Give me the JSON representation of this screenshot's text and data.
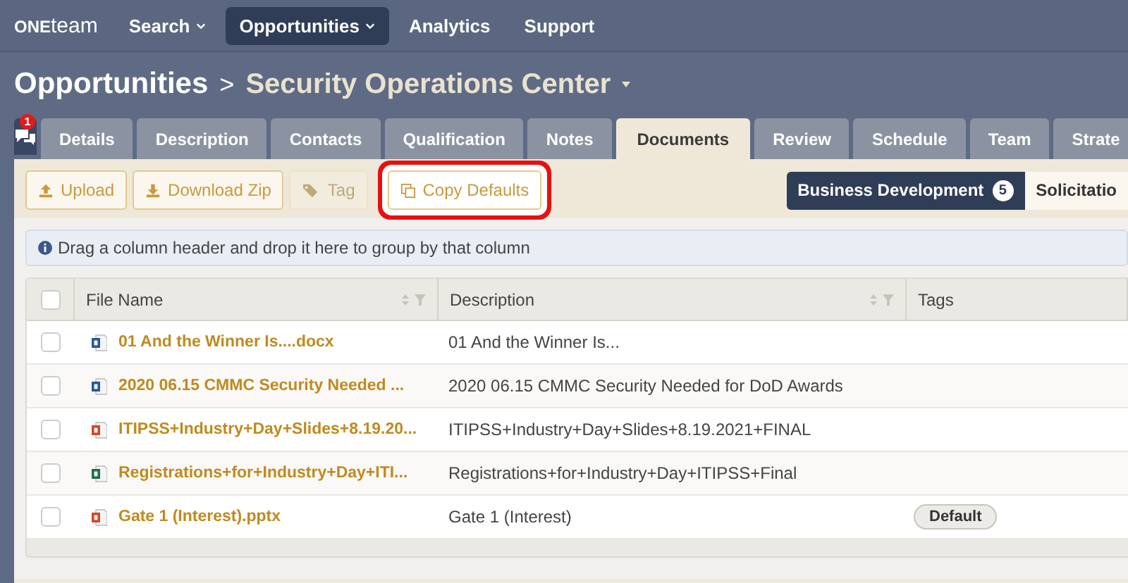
{
  "nav": {
    "logo_bold": "ONE",
    "logo_light": "team",
    "items": [
      {
        "label": "Search",
        "dropdown": true,
        "selected": false
      },
      {
        "label": "Opportunities",
        "dropdown": true,
        "selected": true
      },
      {
        "label": "Analytics",
        "dropdown": false,
        "selected": false
      },
      {
        "label": "Support",
        "dropdown": false,
        "selected": false
      }
    ]
  },
  "breadcrumb": {
    "parent": "Opportunities",
    "separator": ">",
    "current": "Security Operations Center"
  },
  "chat": {
    "badge": "1"
  },
  "tabs": [
    {
      "label": "Details",
      "selected": false
    },
    {
      "label": "Description",
      "selected": false
    },
    {
      "label": "Contacts",
      "selected": false
    },
    {
      "label": "Qualification",
      "selected": false
    },
    {
      "label": "Notes",
      "selected": false
    },
    {
      "label": "Documents",
      "selected": true
    },
    {
      "label": "Review",
      "selected": false
    },
    {
      "label": "Schedule",
      "selected": false
    },
    {
      "label": "Team",
      "selected": false
    },
    {
      "label": "Strate",
      "selected": false
    }
  ],
  "toolbar": {
    "buttons": [
      {
        "label": "Upload",
        "kind": "upload",
        "disabled": false,
        "highlighted": false
      },
      {
        "label": "Download Zip",
        "kind": "download",
        "disabled": false,
        "highlighted": false
      },
      {
        "label": "Tag",
        "kind": "tag",
        "disabled": true,
        "highlighted": false
      },
      {
        "label": "Copy Defaults",
        "kind": "copy",
        "disabled": false,
        "highlighted": true
      }
    ],
    "segments": [
      {
        "label": "Business Development",
        "count": "5",
        "selected": true
      },
      {
        "label": "Solicitatio",
        "selected": false
      }
    ]
  },
  "group_hint": "Drag a column header and drop it here to group by that column",
  "table": {
    "select_all_checked": false,
    "columns": [
      {
        "label": "File Name",
        "sortable": true
      },
      {
        "label": "Description",
        "sortable": true
      },
      {
        "label": "Tags",
        "sortable": false
      }
    ],
    "rows": [
      {
        "checked": false,
        "kind": "word",
        "file_name": "01 And the Winner Is....docx",
        "description": "01 And the Winner Is...",
        "tags": []
      },
      {
        "checked": false,
        "kind": "word",
        "file_name": "2020 06.15 CMMC Security Needed ...",
        "description": "2020 06.15 CMMC Security Needed for DoD Awards",
        "tags": []
      },
      {
        "checked": false,
        "kind": "powerpoint",
        "file_name": "ITIPSS+Industry+Day+Slides+8.19.20...",
        "description": "ITIPSS+Industry+Day+Slides+8.19.2021+FINAL",
        "tags": []
      },
      {
        "checked": false,
        "kind": "excel",
        "file_name": "Registrations+for+Industry+Day+ITI...",
        "description": "Registrations+for+Industry+Day+ITIPSS+Final",
        "tags": []
      },
      {
        "checked": false,
        "kind": "powerpoint",
        "file_name": "Gate 1 (Interest).pptx",
        "description": "Gate 1 (Interest)",
        "tags": [
          "Default"
        ]
      }
    ]
  }
}
